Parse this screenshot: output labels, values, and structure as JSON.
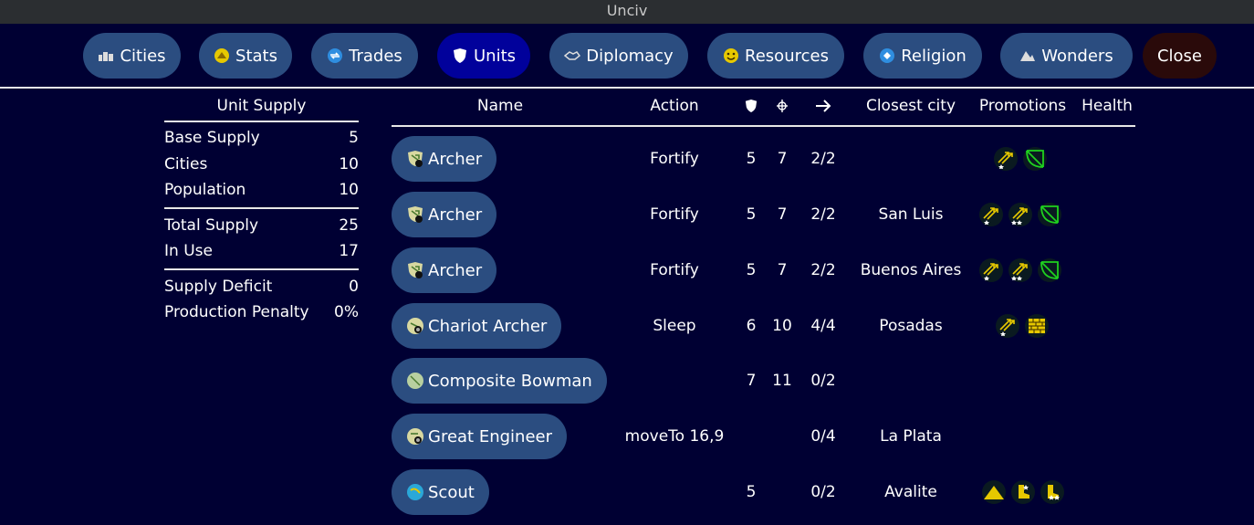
{
  "window": {
    "title": "Unciv"
  },
  "tabs": [
    {
      "label": "Cities",
      "icon": "cities-icon",
      "active": false
    },
    {
      "label": "Stats",
      "icon": "stats-icon",
      "active": false
    },
    {
      "label": "Trades",
      "icon": "trades-icon",
      "active": false
    },
    {
      "label": "Units",
      "icon": "shield-icon",
      "active": true
    },
    {
      "label": "Diplomacy",
      "icon": "diplomacy-icon",
      "active": false
    },
    {
      "label": "Resources",
      "icon": "resources-icon",
      "active": false
    },
    {
      "label": "Religion",
      "icon": "religion-icon",
      "active": false
    },
    {
      "label": "Wonders",
      "icon": "wonders-icon",
      "active": false
    },
    {
      "label": "Close",
      "icon": "",
      "active": false
    }
  ],
  "supply": {
    "header": "Unit Supply",
    "rows": [
      {
        "label": "Base Supply",
        "value": "5"
      },
      {
        "label": "Cities",
        "value": "10"
      },
      {
        "label": "Population",
        "value": "10"
      },
      {
        "label": "Total Supply",
        "value": "25"
      },
      {
        "label": "In Use",
        "value": "17"
      },
      {
        "label": "Supply Deficit",
        "value": "0"
      },
      {
        "label": "Production Penalty",
        "value": "0%"
      }
    ]
  },
  "table": {
    "headers": {
      "name": "Name",
      "action": "Action",
      "strength_icon": "shield-icon",
      "range_icon": "crosshair-icon",
      "movement_icon": "arrow-right-icon",
      "city": "Closest city",
      "promotions": "Promotions",
      "health": "Health"
    },
    "rows": [
      {
        "name": "Archer",
        "action": "Fortify",
        "strength": "5",
        "range": "7",
        "movement": "2/2",
        "city": "",
        "promotions": [
          "arrows-star",
          "bow"
        ]
      },
      {
        "name": "Archer",
        "action": "Fortify",
        "strength": "5",
        "range": "7",
        "movement": "2/2",
        "city": "San Luis",
        "promotions": [
          "arrows-star",
          "arrows-star2",
          "bow"
        ]
      },
      {
        "name": "Archer",
        "action": "Fortify",
        "strength": "5",
        "range": "7",
        "movement": "2/2",
        "city": "Buenos Aires",
        "promotions": [
          "arrows-star",
          "arrows-star2",
          "bow"
        ]
      },
      {
        "name": "Chariot Archer",
        "action": "Sleep",
        "strength": "6",
        "range": "10",
        "movement": "4/4",
        "city": "Posadas",
        "promotions": [
          "arrows-star",
          "wall"
        ]
      },
      {
        "name": "Composite Bowman",
        "action": "",
        "strength": "7",
        "range": "11",
        "movement": "0/2",
        "city": "",
        "promotions": []
      },
      {
        "name": "Great Engineer",
        "action": "moveTo 16,9",
        "strength": "",
        "range": "",
        "movement": "0/4",
        "city": "La Plata",
        "promotions": []
      },
      {
        "name": "Scout",
        "action": "",
        "strength": "5",
        "range": "",
        "movement": "0/2",
        "city": "Avalite",
        "promotions": [
          "triangle",
          "boot-star",
          "boot-star2"
        ]
      }
    ]
  },
  "colors": {
    "background": "#000033",
    "tab": "#2b4d80",
    "tab_active": "#01019b",
    "close": "#2a0a0a",
    "promo_gold": "#e6c800",
    "promo_green": "#1fd11f"
  }
}
